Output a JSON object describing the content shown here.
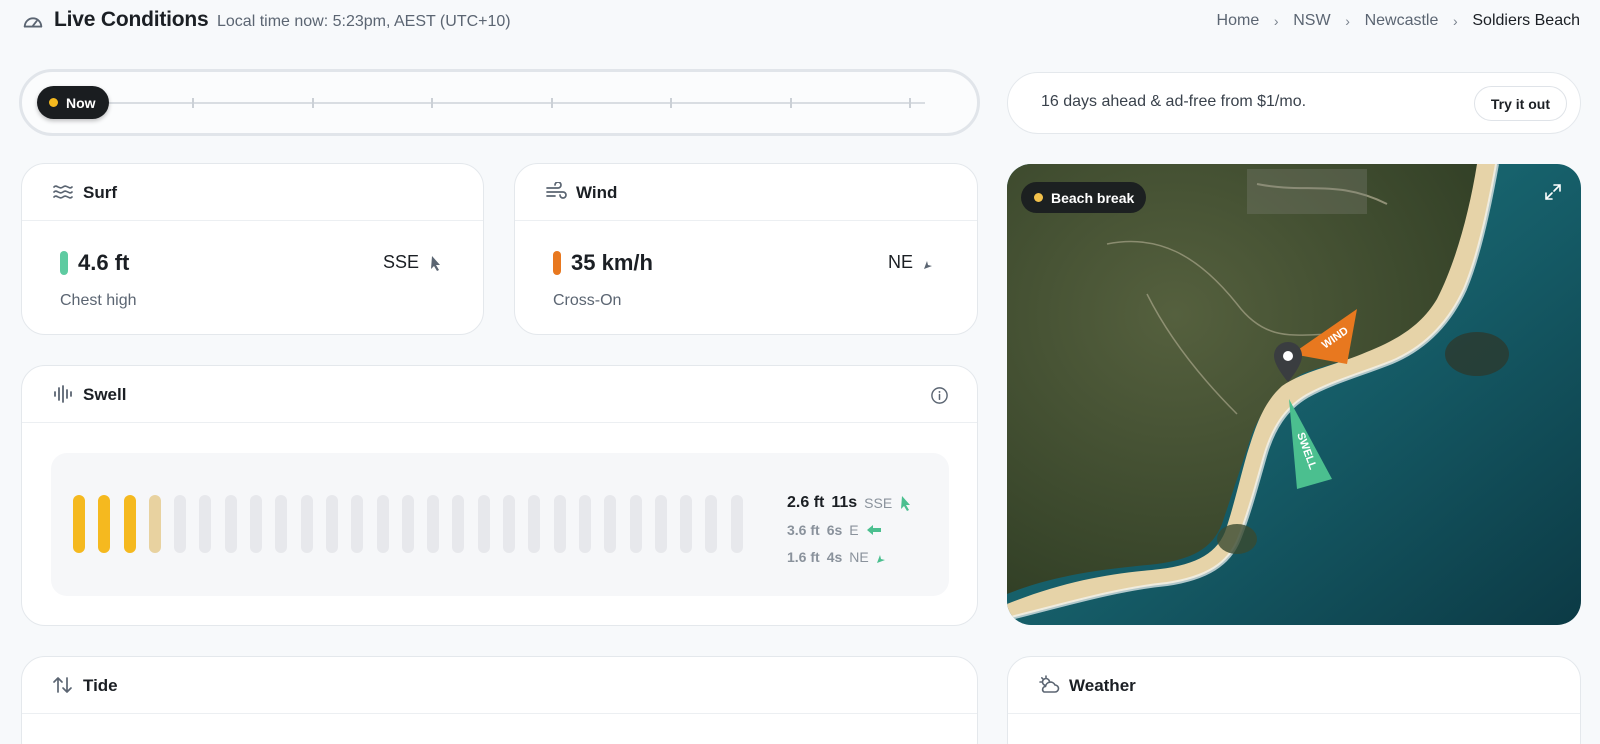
{
  "header": {
    "title": "Live Conditions",
    "local_time": "Local time now: 5:23pm, AEST (UTC+10)",
    "breadcrumbs": [
      "Home",
      "NSW",
      "Newcastle",
      "Soldiers Beach"
    ]
  },
  "timeline": {
    "now_label": "Now",
    "tick_count": 7
  },
  "promo": {
    "text": "16 days ahead & ad-free from $1/mo.",
    "button": "Try it out"
  },
  "surf": {
    "title": "Surf",
    "height": "4.6 ft",
    "description": "Chest high",
    "direction": "SSE",
    "color": "#5ecba1"
  },
  "wind": {
    "title": "Wind",
    "speed": "35 km/h",
    "description": "Cross-On",
    "direction": "NE",
    "color": "#e8781f"
  },
  "swell": {
    "title": "Swell",
    "bar_count": 27,
    "filled_bars": 3,
    "partial_bars": 1,
    "components": [
      {
        "height": "2.6 ft",
        "period": "11s",
        "direction": "SSE"
      },
      {
        "height": "3.6 ft",
        "period": "6s",
        "direction": "E"
      },
      {
        "height": "1.6 ft",
        "period": "4s",
        "direction": "NE"
      }
    ]
  },
  "map": {
    "label": "Beach break",
    "wind_label": "WIND",
    "swell_label": "SWELL"
  },
  "tide": {
    "title": "Tide"
  },
  "weather": {
    "title": "Weather"
  },
  "colors": {
    "accent_yellow": "#f5b91f",
    "swell_green": "#4bbf8f",
    "wind_orange": "#e8781f"
  }
}
